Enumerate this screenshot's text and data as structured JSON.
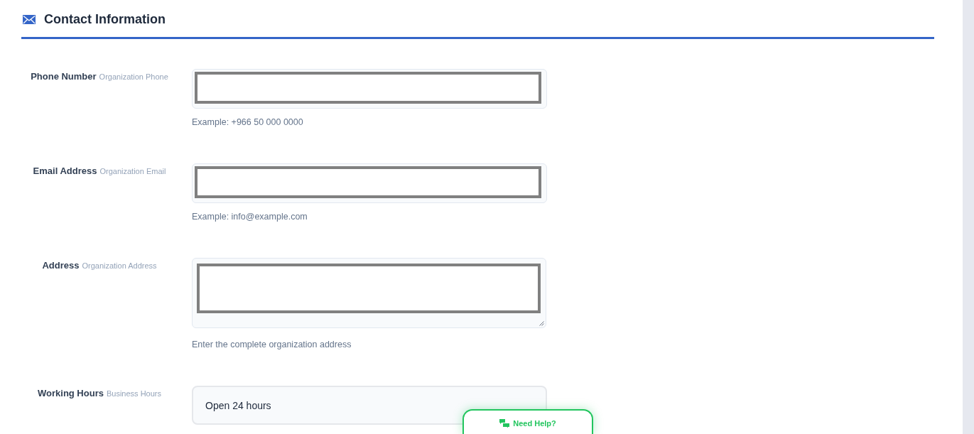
{
  "section": {
    "title": "Contact Information"
  },
  "fields": [
    {
      "label": "Phone Number",
      "sublabel": "Organization Phone",
      "kind": "boxed",
      "hint": "Example: +966 50 000 0000"
    },
    {
      "label": "Email Address",
      "sublabel": "Organization Email",
      "kind": "boxed",
      "hint": "Example: info@example.com"
    },
    {
      "label": "Address",
      "sublabel": "Organization Address",
      "kind": "textarea",
      "hint": "Enter the complete organization address"
    },
    {
      "label": "Working Hours",
      "sublabel": "Business Hours",
      "kind": "plain",
      "value": "Open 24 hours"
    }
  ],
  "help_button": {
    "label": "Need Help?"
  }
}
